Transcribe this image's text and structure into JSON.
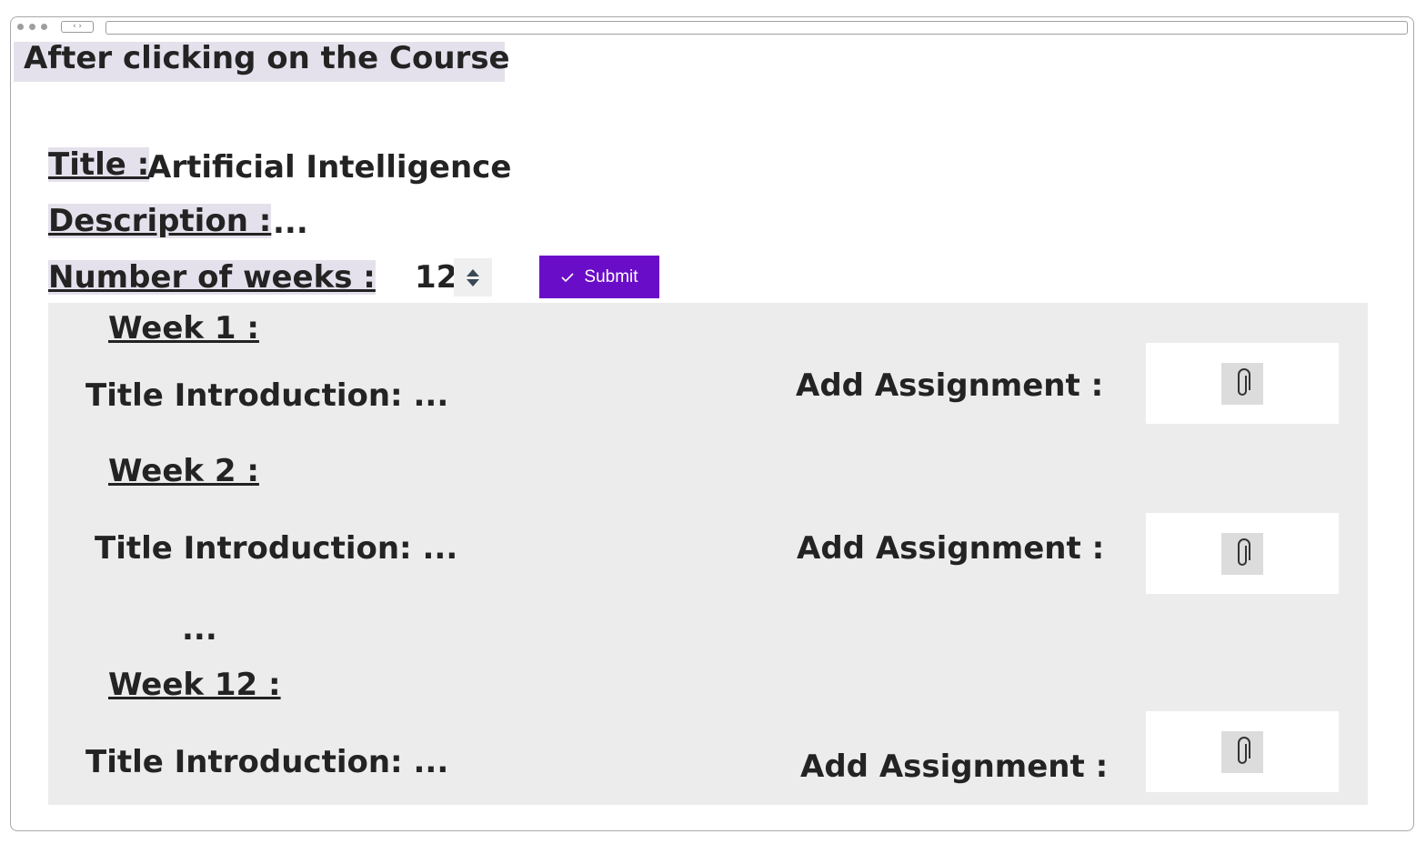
{
  "page": {
    "heading": "After clicking on the Course"
  },
  "course": {
    "title_label": "Title :",
    "title_value": "Artificial Intelligence",
    "description_label": "Description :",
    "description_value": "...",
    "weeks_label": "Number of weeks :",
    "weeks_value": "12",
    "submit_label": "Submit"
  },
  "weeks": [
    {
      "label": "Week 1 :",
      "title_text": "Title Introduction:  ...",
      "assignment_label": "Add Assignment :"
    },
    {
      "label": "Week 2 :",
      "title_text": "Title Introduction:  ...",
      "assignment_label": "Add Assignment :"
    },
    {
      "label": "Week 12 :",
      "title_text": "Title Introduction:  ...",
      "assignment_label": "Add Assignment :"
    }
  ],
  "ellipsis": "...",
  "icons": {
    "attachment": "paperclip-icon",
    "stepper": "stepper-icon",
    "check": "check-icon"
  },
  "colors": {
    "accent": "#6a0dc9",
    "label_highlight": "#e5e1ec",
    "panel": "#ececec"
  }
}
